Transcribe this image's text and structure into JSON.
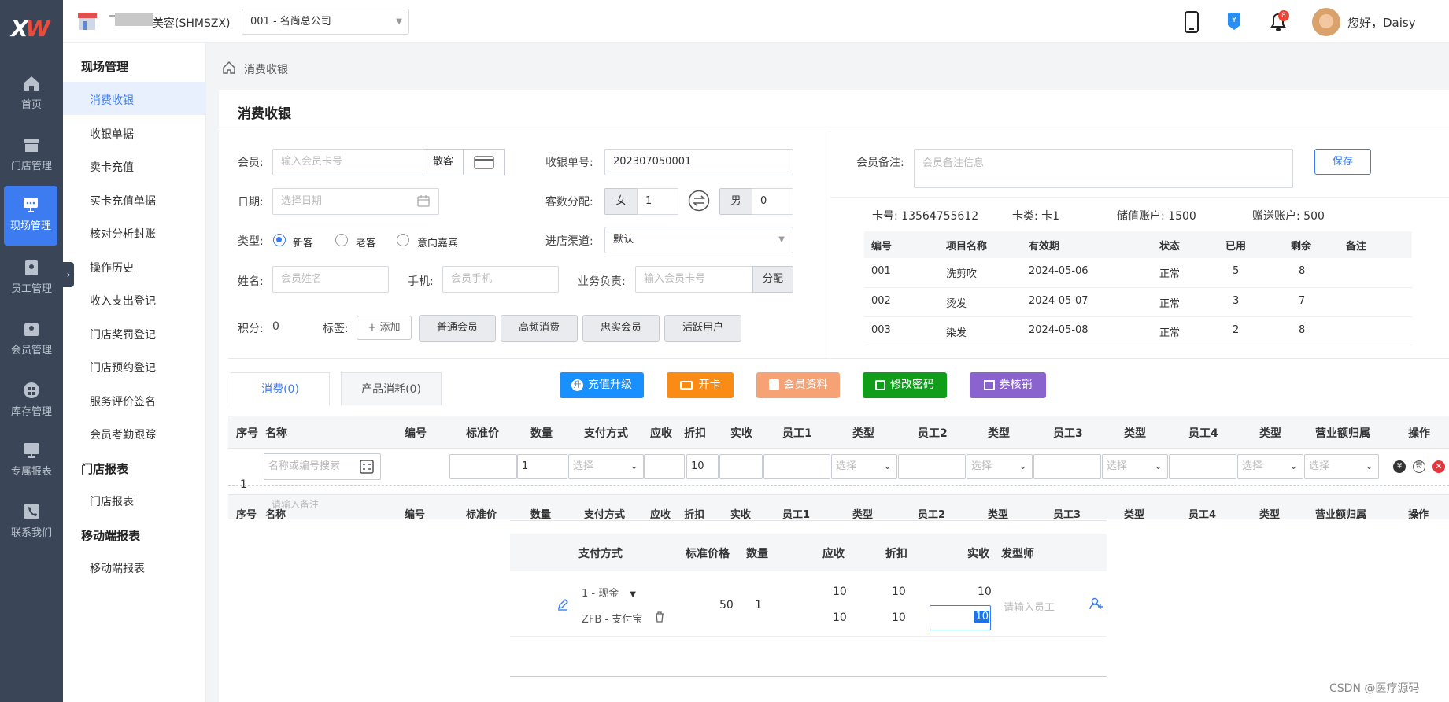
{
  "rail": {
    "items": [
      "首页",
      "门店管理",
      "现场管理",
      "员工管理",
      "会员管理",
      "库存管理",
      "专属报表",
      "联系我们"
    ]
  },
  "sub": {
    "groups": [
      "现场管理",
      "门店报表",
      "移动端报表"
    ],
    "items": [
      "消费收银",
      "收银单据",
      "卖卡充值",
      "买卡充值单据",
      "核对分析封账",
      "操作历史",
      "收入支出登记",
      "门店奖罚登记",
      "门店预约登记",
      "服务评价签名",
      "会员考勤跟踪",
      "门店报表",
      "移动端报表"
    ]
  },
  "header": {
    "store": "美容(SHMSZX)",
    "company": "001 - 名尚总公司",
    "greeting": "您好，Daisy",
    "badge": "8"
  },
  "breadcrumb": "消费收银",
  "page_title": "消费收银",
  "form": {
    "member_label": "会员:",
    "member_ph": "输入会员卡号",
    "walkin": "散客",
    "order_label": "收银单号:",
    "order_no": "202307050001",
    "date_label": "日期:",
    "date_ph": "选择日期",
    "guest_label": "客数分配:",
    "female": "女",
    "female_count": "1",
    "male": "男",
    "male_count": "0",
    "type_label": "类型:",
    "types": [
      "新客",
      "老客",
      "意向嘉宾"
    ],
    "channel_label": "进店渠道:",
    "channel": "默认",
    "name_label": "姓名:",
    "name_ph": "会员姓名",
    "phone_label": "手机:",
    "phone_ph": "会员手机",
    "sales_label": "业务负责:",
    "sales_ph": "输入会员卡号",
    "assign": "分配",
    "points_label": "积分:",
    "points": "0",
    "tags_label": "标签:",
    "add_tag": "+ 添加",
    "tags": [
      "普通会员",
      "高频消费",
      "忠实会员",
      "活跃用户"
    ]
  },
  "member": {
    "note_label": "会员备注:",
    "note_ph": "会员备注信息",
    "save": "保存",
    "card_no": "卡号: 13564755612",
    "card_type": "卡类: 卡1",
    "stored": "储值账户: 1500",
    "gift": "赠送账户: 500",
    "columns": [
      "编号",
      "项目名称",
      "有效期",
      "状态",
      "已用",
      "剩余",
      "备注"
    ],
    "rows": [
      [
        "001",
        "洗剪吹",
        "2024-05-06",
        "正常",
        "5",
        "8",
        ""
      ],
      [
        "002",
        "烫发",
        "2024-05-07",
        "正常",
        "3",
        "7",
        ""
      ],
      [
        "003",
        "染发",
        "2024-05-08",
        "正常",
        "2",
        "8",
        ""
      ]
    ]
  },
  "tabs": [
    "消费(0)",
    "产品消耗(0)"
  ],
  "actions": [
    {
      "label": "充值升级",
      "color": "#1890ff"
    },
    {
      "label": "开卡",
      "color": "#fa8c16"
    },
    {
      "label": "会员资料",
      "color": "#f7a274"
    },
    {
      "label": "修改密码",
      "color": "#0f9d1a"
    },
    {
      "label": "券核销",
      "color": "#8a63cf"
    }
  ],
  "grid": {
    "columns": [
      "序号",
      "名称",
      "编号",
      "标准价",
      "数量",
      "支付方式",
      "应收",
      "折扣",
      "实收",
      "员工1",
      "类型",
      "员工2",
      "类型",
      "员工3",
      "类型",
      "员工4",
      "类型",
      "营业额归属",
      "操作"
    ],
    "row_no": "1",
    "search_ph": "名称或编号搜索",
    "qty": "1",
    "discount": "10",
    "select_ph": "选择",
    "note_ph": "请输入备注"
  },
  "pay": {
    "columns": [
      "支付方式",
      "标准价格",
      "数量",
      "应收",
      "折扣",
      "实收",
      "发型师"
    ],
    "method1": "1 - 现金",
    "method2": "ZFB - 支付宝",
    "price": "50",
    "qty": "1",
    "due1": "10",
    "disc1": "10",
    "paid1": "10",
    "due2": "10",
    "disc2": "10",
    "paid2": "10",
    "stylist_ph": "请输入员工"
  },
  "watermark": "CSDN @医疗源码"
}
